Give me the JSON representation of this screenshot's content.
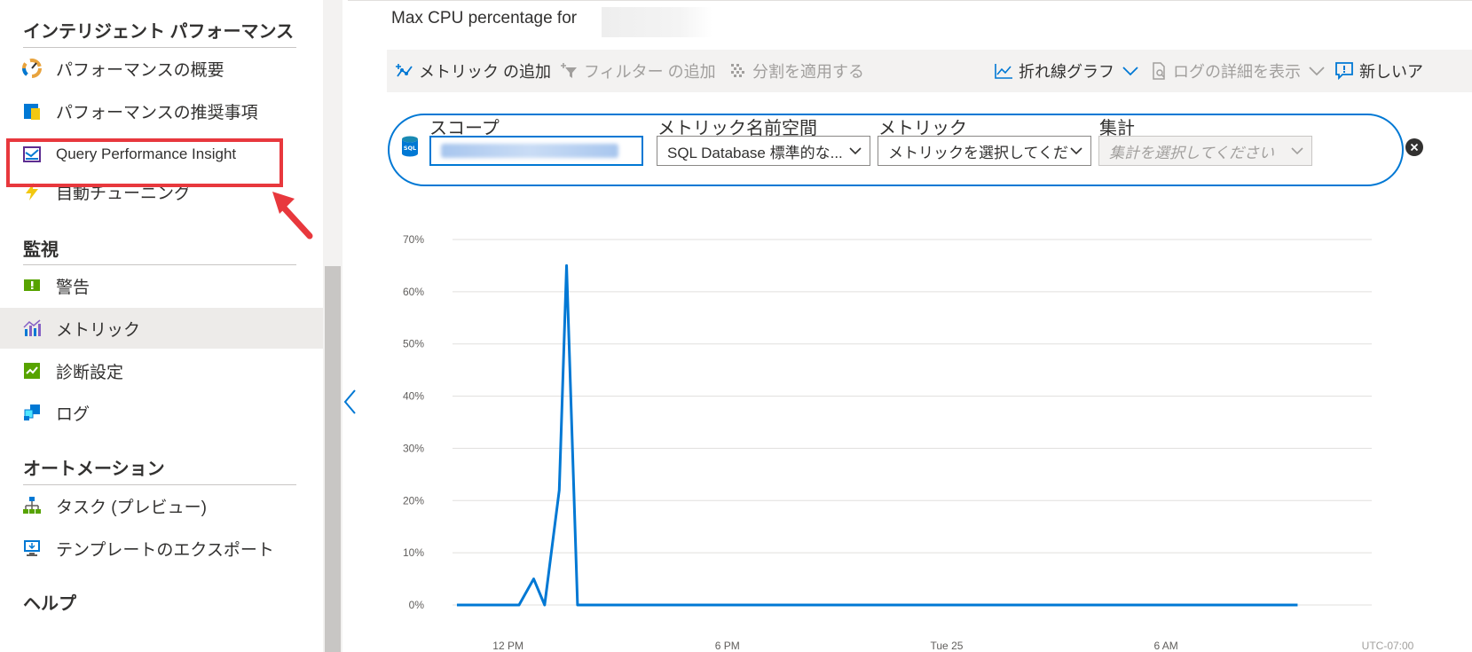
{
  "sidebar": {
    "sections": [
      {
        "title": "インテリジェント パフォーマンス",
        "items": [
          {
            "label": "パフォーマンスの概要",
            "icon": "performance-overview-icon"
          },
          {
            "label": "パフォーマンスの推奨事項",
            "icon": "recommendations-icon"
          },
          {
            "label": "Query Performance Insight",
            "icon": "query-insight-icon"
          },
          {
            "label": "自動チューニング",
            "icon": "lightning-icon"
          }
        ]
      },
      {
        "title": "監視",
        "items": [
          {
            "label": "警告",
            "icon": "alert-icon"
          },
          {
            "label": "メトリック",
            "icon": "metrics-icon",
            "selected": true
          },
          {
            "label": "診断設定",
            "icon": "diagnostic-settings-icon"
          },
          {
            "label": "ログ",
            "icon": "logs-icon"
          }
        ]
      },
      {
        "title": "オートメーション",
        "items": [
          {
            "label": "タスク (プレビュー)",
            "icon": "tasks-icon"
          },
          {
            "label": "テンプレートのエクスポート",
            "icon": "export-template-icon"
          }
        ]
      },
      {
        "title": "ヘルプ",
        "items": []
      }
    ]
  },
  "main": {
    "chart_title": "Max CPU percentage for",
    "toolbar": {
      "add_metric": "メトリック の追加",
      "add_filter": "フィルター の追加",
      "apply_split": "分割を適用する",
      "line_chart": "折れ線グラフ",
      "drill_logs": "ログの詳細を表示",
      "new_alert": "新しいア"
    },
    "scope": {
      "scope_label": "スコープ",
      "namespace_label": "メトリック名前空間",
      "namespace_value": "SQL Database 標準的な...",
      "metric_label": "メトリック",
      "metric_placeholder": "メトリックを選択してくださ",
      "aggregation_label": "集計",
      "aggregation_placeholder": "集計を選択してください"
    }
  },
  "colors": {
    "accent": "#0078d4",
    "highlight": "#e8383d",
    "selected_bg": "#edebe9"
  },
  "chart_data": {
    "type": "line",
    "y_ticks": [
      "70%",
      "60%",
      "50%",
      "40%",
      "30%",
      "20%",
      "10%",
      "0%"
    ],
    "x_ticks": [
      "12 PM",
      "6 PM",
      "Tue 25",
      "6 AM"
    ],
    "timezone": "UTC-07:00",
    "ylim": [
      0,
      70
    ],
    "grid": true,
    "series": [
      {
        "color": "#0078d4",
        "points": [
          [
            0.0,
            0
          ],
          [
            1.7,
            0
          ],
          [
            2.1,
            5
          ],
          [
            2.4,
            0
          ],
          [
            2.8,
            22
          ],
          [
            3.0,
            65
          ],
          [
            3.3,
            0
          ],
          [
            23.0,
            0
          ]
        ]
      }
    ],
    "x_tick_hours": [
      1.4,
      7.4,
      13.4,
      19.4
    ],
    "xlim": [
      -0.8,
      24.3
    ]
  }
}
